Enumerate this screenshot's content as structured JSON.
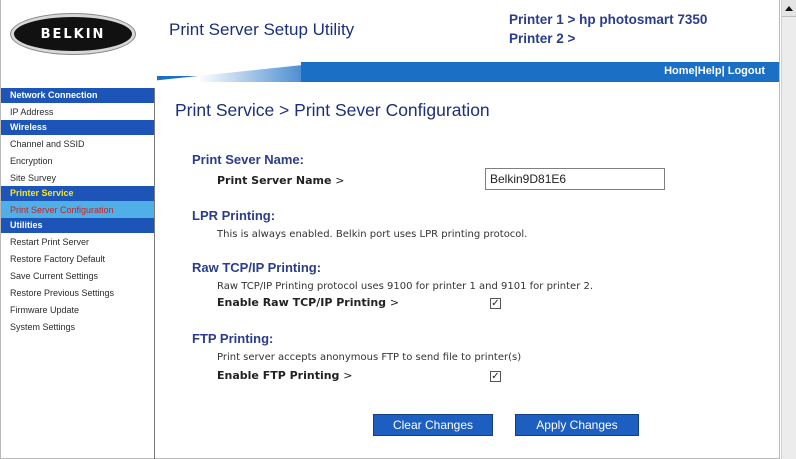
{
  "header": {
    "logo_text": "BELKIN",
    "app_title": "Print Server Setup Utility",
    "printers": [
      "Printer 1 > hp photosmart 7350",
      "Printer 2 >"
    ]
  },
  "nav_links": {
    "home": "Home",
    "sep1": "|",
    "help": "Help",
    "sep2": "| ",
    "logout": "Logout"
  },
  "sidebar": {
    "sections": [
      {
        "title": "Network Connection",
        "items": [
          "IP Address"
        ]
      },
      {
        "title": "Wireless",
        "items": [
          "Channel and SSID",
          "Encryption",
          "Site Survey"
        ]
      },
      {
        "title": "Printer Service",
        "items": [
          "Print Server Configuration"
        ]
      },
      {
        "title": "Utilities",
        "items": [
          "Restart Print Server",
          "Restore Factory Default",
          "Save Current Settings",
          "Restore Previous Settings",
          "Firmware Update",
          "System Settings"
        ]
      }
    ],
    "active_section": "Printer Service",
    "selected_item": "Print Server Configuration"
  },
  "main": {
    "page_title": "Print Service > Print Sever Configuration",
    "server_name": {
      "title": "Print Sever Name:",
      "label": "Print Server Name",
      "gt": ">",
      "value": "Belkin9D81E6"
    },
    "lpr": {
      "title": "LPR Printing:",
      "desc": "This is always enabled. Belkin port uses LPR printing protocol."
    },
    "raw": {
      "title": "Raw TCP/IP Printing:",
      "desc": "Raw TCP/IP Printing protocol uses 9100 for printer 1 and 9101 for printer 2.",
      "label": "Enable Raw TCP/IP Printing",
      "gt": ">",
      "checked": true
    },
    "ftp": {
      "title": "FTP Printing:",
      "desc": "Print server accepts anonymous FTP to send file to printer(s)",
      "label": "Enable FTP Printing",
      "gt": ">",
      "checked": true
    },
    "buttons": {
      "clear": "Clear Changes",
      "apply": "Apply Changes"
    }
  },
  "checkmark": "✓",
  "colors": {
    "brand_blue": "#1b6fc4",
    "sidebar_header": "#1d54b8",
    "active_section_text": "#f5e81f",
    "selected_item_bg": "#4fb0e8",
    "selected_item_text": "#c82020",
    "title_text": "#1c2f7a"
  }
}
